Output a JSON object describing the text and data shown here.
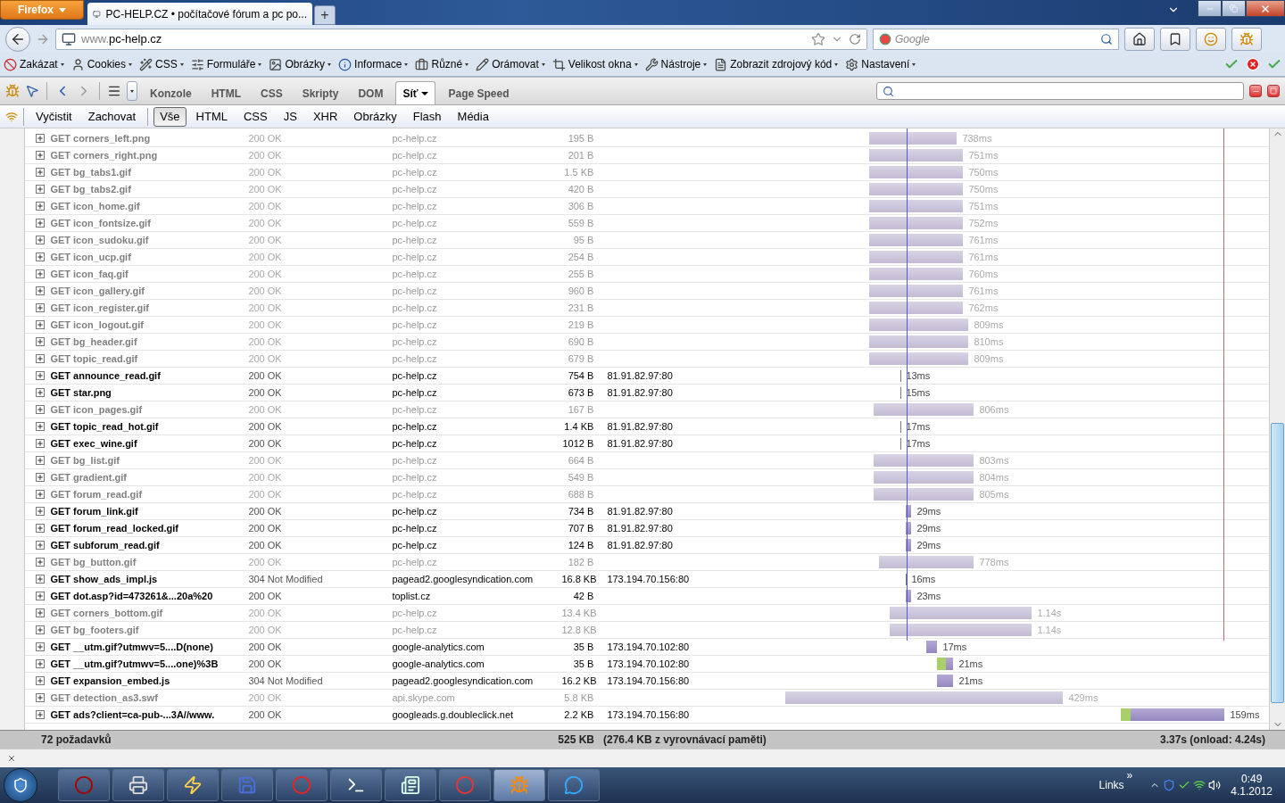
{
  "browser": {
    "menu_button": "Firefox",
    "tabs": [
      {
        "title": "PC-HELP.CZ • počítačové fórum a pc po...",
        "selected": true
      }
    ],
    "new_tab": "+",
    "url": {
      "prefix": "www.",
      "host": "pc-help.cz"
    },
    "search": {
      "placeholder": "Google"
    }
  },
  "webdev_toolbar": [
    "Zakázat",
    "Cookies",
    "CSS",
    "Formuláře",
    "Obrázky",
    "Informace",
    "Různé",
    "Orámovat",
    "Velikost okna",
    "Nástroje",
    "Zobrazit zdrojový kód",
    "Nastavení"
  ],
  "firebug": {
    "panels": [
      {
        "label": "Konzole",
        "selected": false
      },
      {
        "label": "HTML",
        "selected": false
      },
      {
        "label": "CSS",
        "selected": false
      },
      {
        "label": "Skripty",
        "selected": false
      },
      {
        "label": "DOM",
        "selected": false
      },
      {
        "label": "Síť",
        "selected": true
      },
      {
        "label": "Page Speed",
        "selected": false
      }
    ],
    "actions": [
      "Vyčistit",
      "Zachovat"
    ],
    "filters": [
      {
        "label": "Vše",
        "selected": true
      },
      {
        "label": "HTML",
        "selected": false
      },
      {
        "label": "CSS",
        "selected": false
      },
      {
        "label": "JS",
        "selected": false
      },
      {
        "label": "XHR",
        "selected": false
      },
      {
        "label": "Obrázky",
        "selected": false
      },
      {
        "label": "Flash",
        "selected": false
      },
      {
        "label": "Média",
        "selected": false
      }
    ]
  },
  "requests": [
    {
      "name": "GET corners_left.png",
      "status": "200 OK",
      "domain": "pc-help.cz",
      "size": "195 B",
      "time": "738ms",
      "cached": true
    },
    {
      "name": "GET corners_right.png",
      "status": "200 OK",
      "domain": "pc-help.cz",
      "size": "201 B",
      "time": "751ms",
      "cached": true
    },
    {
      "name": "GET bg_tabs1.gif",
      "status": "200 OK",
      "domain": "pc-help.cz",
      "size": "1.5 KB",
      "time": "750ms",
      "cached": true
    },
    {
      "name": "GET bg_tabs2.gif",
      "status": "200 OK",
      "domain": "pc-help.cz",
      "size": "420 B",
      "time": "750ms",
      "cached": true
    },
    {
      "name": "GET icon_home.gif",
      "status": "200 OK",
      "domain": "pc-help.cz",
      "size": "306 B",
      "time": "751ms",
      "cached": true
    },
    {
      "name": "GET icon_fontsize.gif",
      "status": "200 OK",
      "domain": "pc-help.cz",
      "size": "559 B",
      "time": "752ms",
      "cached": true
    },
    {
      "name": "GET icon_sudoku.gif",
      "status": "200 OK",
      "domain": "pc-help.cz",
      "size": "95 B",
      "time": "761ms",
      "cached": true
    },
    {
      "name": "GET icon_ucp.gif",
      "status": "200 OK",
      "domain": "pc-help.cz",
      "size": "254 B",
      "time": "761ms",
      "cached": true
    },
    {
      "name": "GET icon_faq.gif",
      "status": "200 OK",
      "domain": "pc-help.cz",
      "size": "255 B",
      "time": "760ms",
      "cached": true
    },
    {
      "name": "GET icon_gallery.gif",
      "status": "200 OK",
      "domain": "pc-help.cz",
      "size": "960 B",
      "time": "761ms",
      "cached": true
    },
    {
      "name": "GET icon_register.gif",
      "status": "200 OK",
      "domain": "pc-help.cz",
      "size": "231 B",
      "time": "762ms",
      "cached": true
    },
    {
      "name": "GET icon_logout.gif",
      "status": "200 OK",
      "domain": "pc-help.cz",
      "size": "219 B",
      "time": "809ms",
      "cached": true
    },
    {
      "name": "GET bg_header.gif",
      "status": "200 OK",
      "domain": "pc-help.cz",
      "size": "690 B",
      "time": "810ms",
      "cached": true
    },
    {
      "name": "GET topic_read.gif",
      "status": "200 OK",
      "domain": "pc-help.cz",
      "size": "679 B",
      "time": "809ms",
      "cached": true
    },
    {
      "name": "GET announce_read.gif",
      "status": "200 OK",
      "domain": "pc-help.cz",
      "size": "754 B",
      "ip": "81.91.82.97:80",
      "time": "13ms",
      "cached": false
    },
    {
      "name": "GET star.png",
      "status": "200 OK",
      "domain": "pc-help.cz",
      "size": "673 B",
      "ip": "81.91.82.97:80",
      "time": "15ms",
      "cached": false
    },
    {
      "name": "GET icon_pages.gif",
      "status": "200 OK",
      "domain": "pc-help.cz",
      "size": "167 B",
      "time": "806ms",
      "cached": true
    },
    {
      "name": "GET topic_read_hot.gif",
      "status": "200 OK",
      "domain": "pc-help.cz",
      "size": "1.4 KB",
      "ip": "81.91.82.97:80",
      "time": "17ms",
      "cached": false
    },
    {
      "name": "GET exec_wine.gif",
      "status": "200 OK",
      "domain": "pc-help.cz",
      "size": "1012 B",
      "ip": "81.91.82.97:80",
      "time": "17ms",
      "cached": false
    },
    {
      "name": "GET bg_list.gif",
      "status": "200 OK",
      "domain": "pc-help.cz",
      "size": "664 B",
      "time": "803ms",
      "cached": true
    },
    {
      "name": "GET gradient.gif",
      "status": "200 OK",
      "domain": "pc-help.cz",
      "size": "549 B",
      "time": "804ms",
      "cached": true
    },
    {
      "name": "GET forum_read.gif",
      "status": "200 OK",
      "domain": "pc-help.cz",
      "size": "688 B",
      "time": "805ms",
      "cached": true
    },
    {
      "name": "GET forum_link.gif",
      "status": "200 OK",
      "domain": "pc-help.cz",
      "size": "734 B",
      "ip": "81.91.82.97:80",
      "time": "29ms",
      "cached": false
    },
    {
      "name": "GET forum_read_locked.gif",
      "status": "200 OK",
      "domain": "pc-help.cz",
      "size": "707 B",
      "ip": "81.91.82.97:80",
      "time": "29ms",
      "cached": false
    },
    {
      "name": "GET subforum_read.gif",
      "status": "200 OK",
      "domain": "pc-help.cz",
      "size": "124 B",
      "ip": "81.91.82.97:80",
      "time": "29ms",
      "cached": false
    },
    {
      "name": "GET bg_button.gif",
      "status": "200 OK",
      "domain": "pc-help.cz",
      "size": "182 B",
      "time": "778ms",
      "cached": true
    },
    {
      "name": "GET show_ads_impl.js",
      "status": "304 Not Modified",
      "domain": "pagead2.googlesyndication.com",
      "size": "16.8 KB",
      "ip": "173.194.70.156:80",
      "time": "16ms",
      "cached": false
    },
    {
      "name": "GET dot.asp?id=473261&...20a%20",
      "status": "200 OK",
      "domain": "toplist.cz",
      "size": "42 B",
      "time": "23ms",
      "cached": false
    },
    {
      "name": "GET corners_bottom.gif",
      "status": "200 OK",
      "domain": "pc-help.cz",
      "size": "13.4 KB",
      "time": "1.14s",
      "cached": true
    },
    {
      "name": "GET bg_footers.gif",
      "status": "200 OK",
      "domain": "pc-help.cz",
      "size": "12.8 KB",
      "time": "1.14s",
      "cached": true
    },
    {
      "name": "GET __utm.gif?utmwv=5....D(none)",
      "status": "200 OK",
      "domain": "google-analytics.com",
      "size": "35 B",
      "ip": "173.194.70.102:80",
      "time": "17ms",
      "cached": false
    },
    {
      "name": "GET __utm.gif?utmwv=5....one)%3B",
      "status": "200 OK",
      "domain": "google-analytics.com",
      "size": "35 B",
      "ip": "173.194.70.102:80",
      "time": "21ms",
      "cached": false
    },
    {
      "name": "GET expansion_embed.js",
      "status": "304 Not Modified",
      "domain": "pagead2.googlesyndication.com",
      "size": "16.2 KB",
      "ip": "173.194.70.156:80",
      "time": "21ms",
      "cached": false
    },
    {
      "name": "GET detection_as3.swf",
      "status": "200 OK",
      "domain": "api.skype.com",
      "size": "5.8 KB",
      "time": "429ms",
      "cached": true
    },
    {
      "name": "GET ads?client=ca-pub-...3A//www.",
      "status": "200 OK",
      "domain": "googleads.g.doubleclick.net",
      "size": "2.2 KB",
      "ip": "173.194.70.156:80",
      "time": "159ms",
      "cached": false
    }
  ],
  "summary": {
    "count": "72 požadavků",
    "size": "525 KB",
    "cache": "(276.4 KB z vyrovnávací paměti)",
    "time": "3.37s (onload: 4.24s)"
  },
  "taskbar": {
    "links": "Links",
    "chevron": "»",
    "time": "0:49",
    "date": "4.1.2012"
  }
}
